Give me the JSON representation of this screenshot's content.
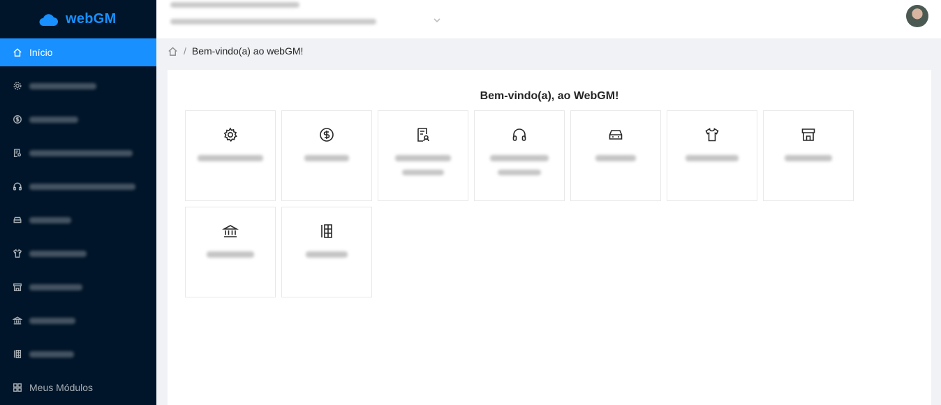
{
  "app": {
    "name": "webGM"
  },
  "sidebar": {
    "items": [
      {
        "label": "Início",
        "icon": "home-icon",
        "active": true
      },
      {
        "label": "",
        "icon": "gear-icon"
      },
      {
        "label": "",
        "icon": "dollar-icon"
      },
      {
        "label": "",
        "icon": "certificate-icon"
      },
      {
        "label": "",
        "icon": "headphones-icon"
      },
      {
        "label": "",
        "icon": "car-icon"
      },
      {
        "label": "",
        "icon": "shirt-icon"
      },
      {
        "label": "",
        "icon": "store-icon"
      },
      {
        "label": "",
        "icon": "bank-icon"
      },
      {
        "label": "",
        "icon": "building-icon"
      },
      {
        "label": "Meus Módulos",
        "icon": "grid-icon"
      }
    ]
  },
  "breadcrumb": {
    "current": "Bem-vindo(a) ao webGM!",
    "separator": "/"
  },
  "main": {
    "title": "Bem-vindo(a), ao WebGM!",
    "modules": [
      {
        "icon": "gear-icon"
      },
      {
        "icon": "dollar-icon"
      },
      {
        "icon": "certificate-icon"
      },
      {
        "icon": "headphones-icon"
      },
      {
        "icon": "car-icon"
      },
      {
        "icon": "shirt-icon"
      },
      {
        "icon": "store-icon"
      },
      {
        "icon": "bank-icon"
      },
      {
        "icon": "building-icon"
      }
    ]
  },
  "colors": {
    "sidebar_bg": "#001529",
    "accent": "#1890ff",
    "page_bg": "#f0f2f5"
  }
}
